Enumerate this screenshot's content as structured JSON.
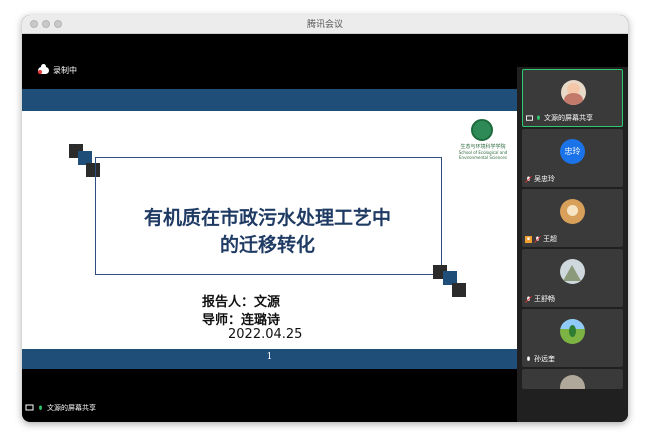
{
  "window": {
    "title": "腾讯会议"
  },
  "recording": {
    "label": "录制中"
  },
  "slide": {
    "title_line1": "有机质在市政污水处理工艺中",
    "title_line2": "的迁移转化",
    "reporter": "报告人：文源",
    "advisor": "导师：连璐诗",
    "date": "2022.04.25",
    "page_number": "1",
    "logo_text_cn": "生态与环境科学学院",
    "logo_text_en": "School of Ecological and Environmental Sciences"
  },
  "participants": [
    {
      "name": "文源的屏幕共享",
      "sharing": true
    },
    {
      "name": "吴忠玲",
      "avatar_text": "忠玲",
      "avatar_color": "#1a73e8"
    },
    {
      "name": "王超"
    },
    {
      "name": "王舒畅"
    },
    {
      "name": "孙远奎"
    }
  ],
  "share_status": {
    "label": "文源的屏幕共享"
  },
  "colors": {
    "slide_band": "#1f4e79",
    "active_border": "#2ecc71"
  }
}
